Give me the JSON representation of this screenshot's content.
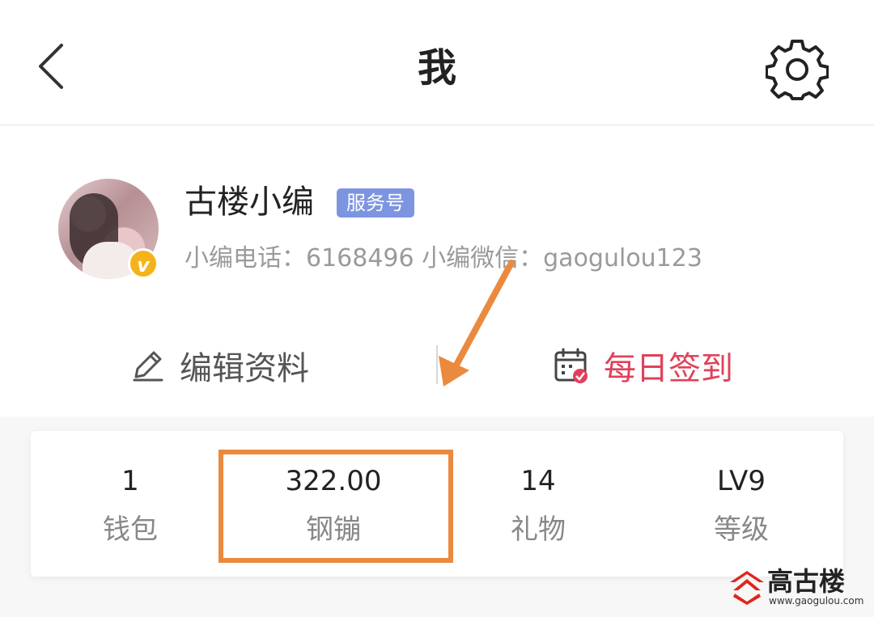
{
  "header": {
    "title": "我",
    "back_icon": "chevron-left-icon",
    "settings_icon": "gear-icon"
  },
  "profile": {
    "username": "古楼小编",
    "service_tag": "服务号",
    "contact": "小编电话：6168496 小编微信：gaogulou123",
    "badge_text": "v"
  },
  "actions": {
    "edit_label": "编辑资料",
    "checkin_label": "每日签到",
    "checkin_color": "#e0415a"
  },
  "stats": [
    {
      "value": "1",
      "label": "钱包"
    },
    {
      "value": "322.00",
      "label": "钢镚"
    },
    {
      "value": "14",
      "label": "礼物"
    },
    {
      "value": "LV9",
      "label": "等级"
    }
  ],
  "annotation": {
    "color": "#ea8a3f"
  },
  "watermark": {
    "name": "高古楼",
    "url": "www.gaogulou.com"
  }
}
